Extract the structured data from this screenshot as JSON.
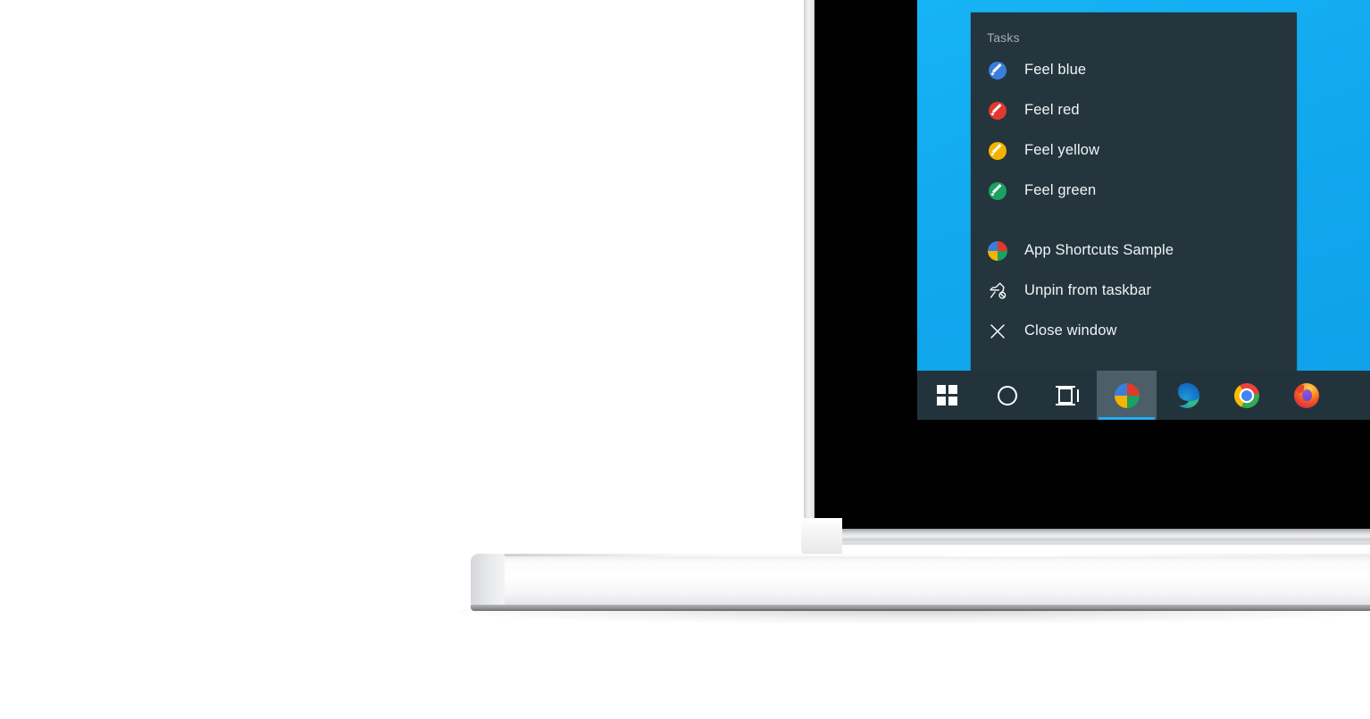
{
  "device": {
    "type": "laptop",
    "screen_background_color": "#12a9ef"
  },
  "jumplist": {
    "background_color": "#24353d",
    "header": "Tasks",
    "tasks": [
      {
        "label": "Feel blue",
        "icon": "pencil-circle-icon",
        "color": "#3b7ddd"
      },
      {
        "label": "Feel red",
        "icon": "pencil-circle-icon",
        "color": "#e03a2f"
      },
      {
        "label": "Feel yellow",
        "icon": "pencil-circle-icon",
        "color": "#f5b400"
      },
      {
        "label": "Feel green",
        "icon": "pencil-circle-icon",
        "color": "#1aa260"
      }
    ],
    "actions": [
      {
        "label": "App Shortcuts Sample",
        "icon": "app-pie-icon"
      },
      {
        "label": "Unpin from taskbar",
        "icon": "unpin-icon"
      },
      {
        "label": "Close window",
        "icon": "close-icon"
      }
    ]
  },
  "taskbar": {
    "background_color": "#23333b",
    "active_highlight_color": "#2aa9f0",
    "items": [
      {
        "name": "start-button",
        "icon": "windows-logo-icon",
        "active": false
      },
      {
        "name": "cortana-button",
        "icon": "cortana-circle-icon",
        "active": false
      },
      {
        "name": "task-view-button",
        "icon": "task-view-icon",
        "active": false
      },
      {
        "name": "app-shortcuts-sample",
        "icon": "app-pie-icon",
        "active": true
      },
      {
        "name": "microsoft-edge",
        "icon": "edge-icon",
        "active": false
      },
      {
        "name": "google-chrome",
        "icon": "chrome-icon",
        "active": false
      },
      {
        "name": "mozilla-firefox",
        "icon": "firefox-icon",
        "active": false
      }
    ]
  }
}
